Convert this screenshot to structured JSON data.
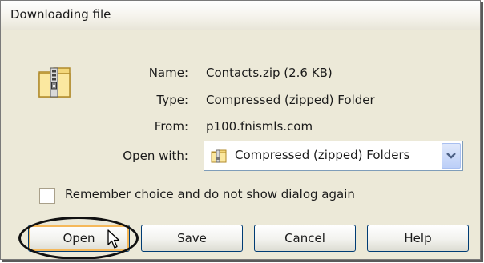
{
  "dialog": {
    "title": "Downloading file",
    "icon": "zip-folder-icon",
    "fields": [
      {
        "label": "Name:",
        "value": "Contacts.zip (2.6 KB)"
      },
      {
        "label": "Type:",
        "value": "Compressed (zipped) Folder"
      },
      {
        "label": "From:",
        "value": "p100.fnismls.com"
      }
    ],
    "open_with": {
      "label": "Open with:",
      "selected": "Compressed (zipped) Folders",
      "icon": "zip-folder-icon"
    },
    "remember": {
      "label": "Remember choice and do not show dialog again",
      "checked": false
    },
    "buttons": {
      "open": "Open",
      "save": "Save",
      "cancel": "Cancel",
      "help": "Help"
    },
    "annotation": "Open button circled with mouse cursor hovering",
    "colors": {
      "dialog_bg": "#ECE9D8",
      "button_border": "#003c74",
      "default_focus": "#f5b85a",
      "dropdown_button": "#bccff8"
    }
  }
}
